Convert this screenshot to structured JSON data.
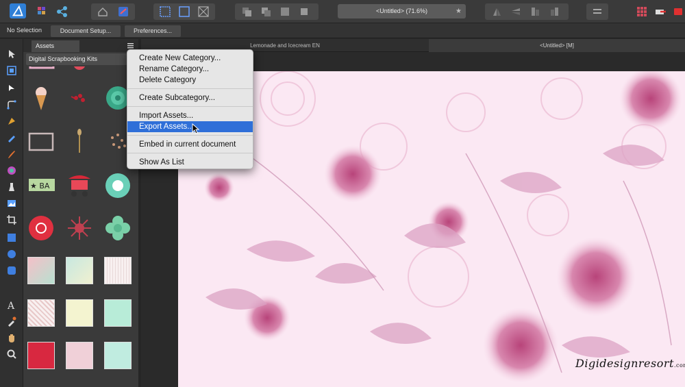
{
  "toolbar": {
    "document_title": "<Untitled> (71.6%)"
  },
  "context": {
    "selection_label": "No Selection",
    "document_setup_label": "Document Setup...",
    "preferences_label": "Preferences..."
  },
  "panel": {
    "tab_label": "Assets",
    "category": "Digital Scrapbooking Kits"
  },
  "doc_tabs": [
    {
      "label": "Lemonade and Icecream EN"
    },
    {
      "label": "<Untitled> [M]"
    }
  ],
  "menu": {
    "items": [
      {
        "label": "Create New Category..."
      },
      {
        "label": "Rename Category..."
      },
      {
        "label": "Delete Category"
      },
      {
        "label": "Create Subcategory..."
      },
      {
        "label": "Import Assets..."
      },
      {
        "label": "Export Assets..."
      },
      {
        "label": "Embed in current document"
      },
      {
        "label": "Show As List"
      }
    ],
    "highlighted_index": 5
  },
  "watermark": {
    "text": "Digidesignresort",
    "suffix": ".com"
  },
  "colors": {
    "accent": "#2f6fd8",
    "canvas_bg": "#fbe8f3",
    "rose": "#c9799f"
  }
}
